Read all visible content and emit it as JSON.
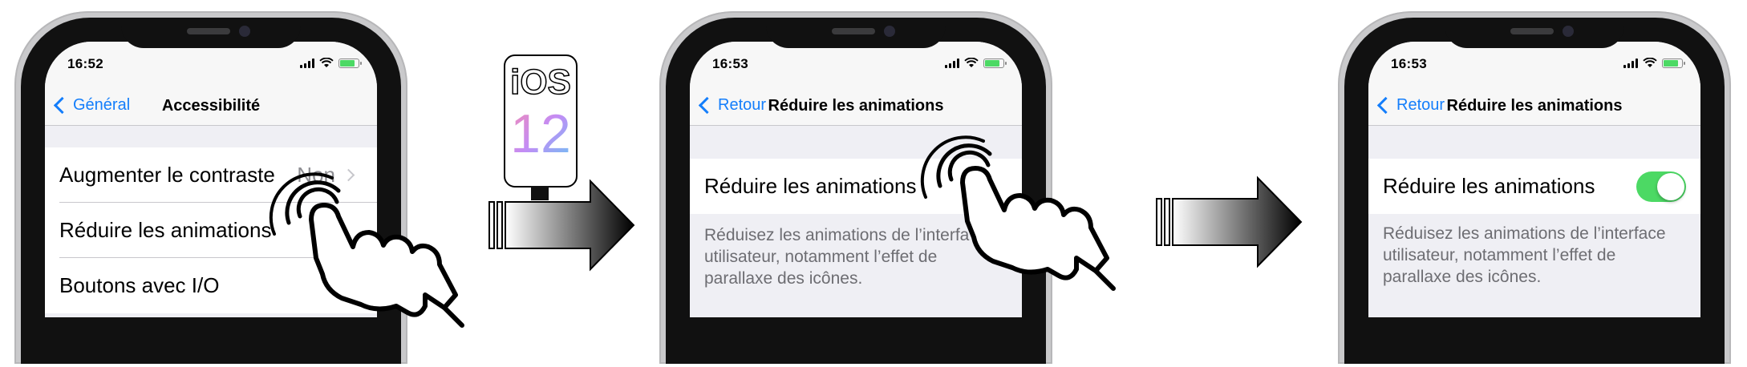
{
  "screens": [
    {
      "time": "16:52",
      "back_label": "Général",
      "title": "Accessibilité",
      "rows": [
        {
          "label": "Augmenter le contraste",
          "value": "Non"
        },
        {
          "label": "Réduire les animations"
        },
        {
          "label": "Boutons avec I/O"
        }
      ]
    },
    {
      "time": "16:53",
      "back_label": "Retour",
      "title": "Réduire les animations",
      "row_label": "Réduire les animations",
      "footer": [
        "Réduisez les animations de l’interfa",
        "utilisateur, notamment l’effet de",
        "parallaxe des icônes."
      ]
    },
    {
      "time": "16:53",
      "back_label": "Retour",
      "title": "Réduire les animations",
      "row_label": "Réduire les animations",
      "toggle_on": true,
      "footer": [
        "Réduisez les animations de l’interface",
        "utilisateur, notamment l’effet de",
        "parallaxe des icônes."
      ]
    }
  ],
  "badge": {
    "os": "iOS",
    "version": "12"
  },
  "colors": {
    "accent": "#147efb",
    "toggle_on": "#4cd964",
    "background": "#efeff4"
  }
}
